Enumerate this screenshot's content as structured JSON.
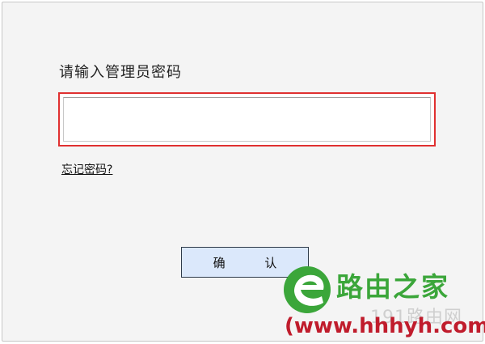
{
  "login": {
    "prompt": "请输入管理员密码",
    "password_value": "",
    "forgot_password": "忘记密码?",
    "confirm_button": "确 认"
  },
  "watermark": {
    "logo_icon": "leaf-e-logo-icon",
    "name": "路由之家",
    "faint_text": "191路由网",
    "url": "(www.hhhyh.com)",
    "colors": {
      "green": "#3ba63a",
      "red": "#c01c2c"
    }
  },
  "colors": {
    "highlight_border": "#e03030",
    "button_bg": "#dbe8fb",
    "dialog_bg": "#f4f4f4"
  }
}
